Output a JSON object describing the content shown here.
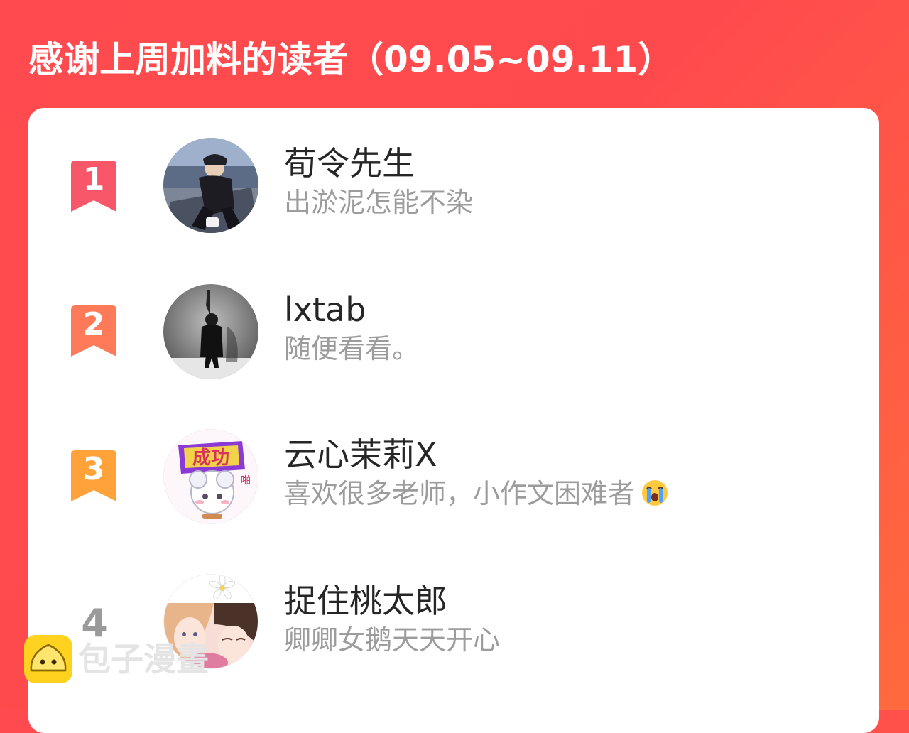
{
  "header": {
    "title": "感谢上周加料的读者（09.05~09.11）"
  },
  "readers": [
    {
      "rank": "1",
      "name": "荀令先生",
      "signature": "出淤泥怎能不染",
      "avatar": "avatar-photo-1",
      "badge_color": "#f8576a"
    },
    {
      "rank": "2",
      "name": "lxtab",
      "signature": "随便看看。",
      "avatar": "avatar-photo-2",
      "badge_color": "#ff7a58"
    },
    {
      "rank": "3",
      "name": "云心茉莉X",
      "signature": "喜欢很多老师，小作文困难者",
      "signature_emoji": "crying-face-icon",
      "avatar": "avatar-photo-3",
      "badge_color": "#ffa23a"
    },
    {
      "rank": "4",
      "name": "捉住桃太郎",
      "signature": "卿卿女鹅天天开心",
      "avatar": "avatar-photo-4"
    }
  ],
  "watermark": {
    "text": "包子漫畫",
    "icon": "bun-logo-icon"
  },
  "colors": {
    "background": "#ff4b4f",
    "card": "#ffffff",
    "name": "#262626",
    "signature": "#9c9c9c"
  }
}
